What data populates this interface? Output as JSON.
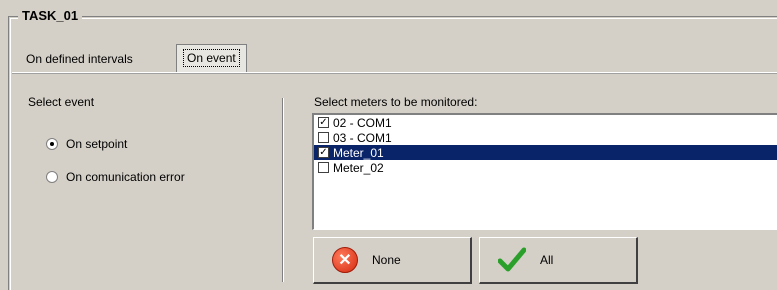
{
  "group": {
    "title": "TASK_01"
  },
  "tabs": [
    {
      "label": "On defined intervals",
      "active": false
    },
    {
      "label": "On event",
      "active": true
    }
  ],
  "event_section": {
    "label": "Select event",
    "options": [
      {
        "label": "On setpoint",
        "checked": true
      },
      {
        "label": "On comunication error",
        "checked": false
      }
    ]
  },
  "meters_section": {
    "label": "Select meters to be monitored:",
    "items": [
      {
        "label": "02 - COM1",
        "checked": true,
        "selected": false
      },
      {
        "label": "03 - COM1",
        "checked": false,
        "selected": false
      },
      {
        "label": "Meter_01",
        "checked": true,
        "selected": true
      },
      {
        "label": "Meter_02",
        "checked": false,
        "selected": false
      }
    ]
  },
  "buttons": {
    "none_label": "None",
    "all_label": "All"
  },
  "colors": {
    "window_bg": "#d4d0c8",
    "selection": "#0a246a",
    "icon_none": "#d42a10",
    "icon_all": "#2aa02a"
  }
}
